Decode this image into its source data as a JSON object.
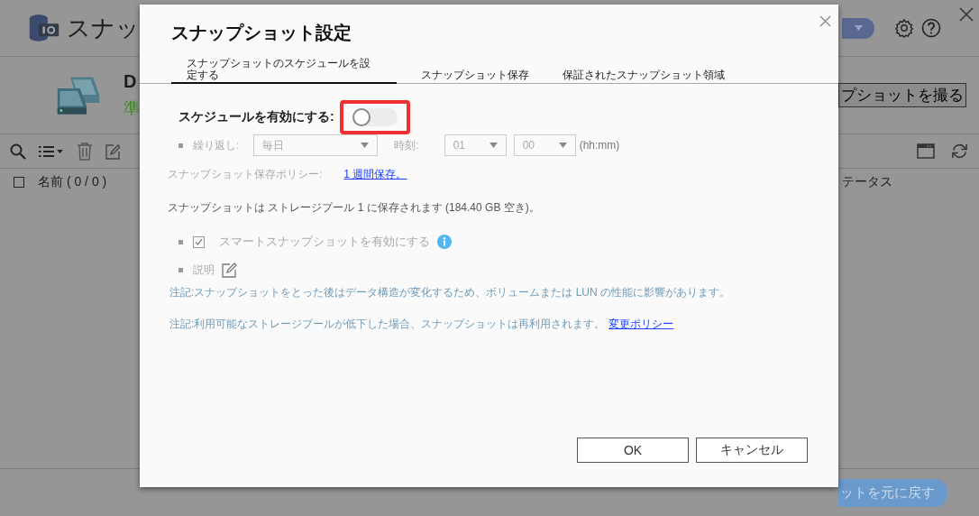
{
  "app": {
    "title": "スナッ",
    "volume_name": "D",
    "volume_status": "準",
    "take_snapshot_button": "プショットを撮る",
    "select_all": {
      "checked": false
    },
    "columns": [
      {
        "label": "名前 ( 0 / 0 )"
      },
      {
        "label": "テータス"
      }
    ],
    "restore_button": "ットを元に戻す"
  },
  "dialog": {
    "title": "スナップショット設定",
    "tabs": [
      {
        "label": "スナップショットのスケジュールを設定する",
        "selected": true
      },
      {
        "label": "スナップショット保存",
        "selected": false
      },
      {
        "label": "保証されたスナップショット領域",
        "selected": false
      }
    ],
    "schedule": {
      "label": "スケジュールを有効にする:",
      "on": false,
      "highlighted": true
    },
    "repeat": {
      "label": "繰り返し:",
      "value": "毎日"
    },
    "time": {
      "label": "時刻:",
      "hour": "01",
      "minute": "00",
      "format": "(hh:mm)"
    },
    "retention": {
      "label": "スナップショット保存ポリシー:",
      "link": "1 週間保存。"
    },
    "storage_note": "スナップショットは ストレージプール 1 に保存されます (184.40 GB 空き)。",
    "smart_snapshot": {
      "label": "スマートスナップショットを有効にする",
      "checked": true
    },
    "description": {
      "label": "説明"
    },
    "notes": [
      {
        "text": "注記:スナップショットをとった後はデータ構造が変化するため、ボリュームまたは LUN の性能に影響があります。"
      },
      {
        "text": "注記:利用可能なストレージプールが低下した場合、スナップショットは再利用されます。",
        "link": "変更ポリシー"
      }
    ],
    "buttons": [
      "OK",
      "キャンセル"
    ]
  }
}
